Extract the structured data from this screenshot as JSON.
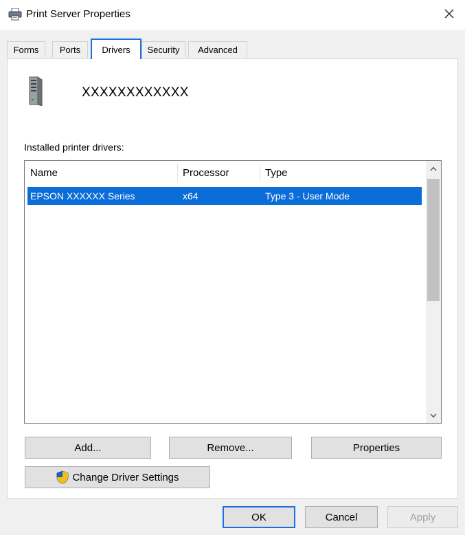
{
  "window": {
    "title": "Print Server Properties"
  },
  "tabs": [
    {
      "label": "Forms"
    },
    {
      "label": "Ports"
    },
    {
      "label": "Drivers"
    },
    {
      "label": "Security"
    },
    {
      "label": "Advanced"
    }
  ],
  "active_tab": "Drivers",
  "drivers_tab": {
    "server_name": "XXXXXXXXXXXX",
    "list_label": "Installed printer drivers:",
    "columns": [
      "Name",
      "Processor",
      "Type"
    ],
    "rows": [
      {
        "name": "EPSON XXXXXX Series",
        "processor": "x64",
        "type": "Type 3 - User Mode",
        "selected": true
      }
    ],
    "buttons": {
      "add": "Add...",
      "remove": "Remove...",
      "properties": "Properties",
      "change_settings": "Change Driver Settings"
    }
  },
  "footer": {
    "ok": "OK",
    "cancel": "Cancel",
    "apply": "Apply"
  },
  "colors": {
    "selection": "#0a6dd8",
    "focus_border": "#1a6fde",
    "window_bg": "#f0f0f0"
  },
  "icons": [
    "printer-icon",
    "close-icon",
    "server-icon",
    "scroll-up-icon",
    "scroll-down-icon",
    "uac-shield-icon"
  ]
}
